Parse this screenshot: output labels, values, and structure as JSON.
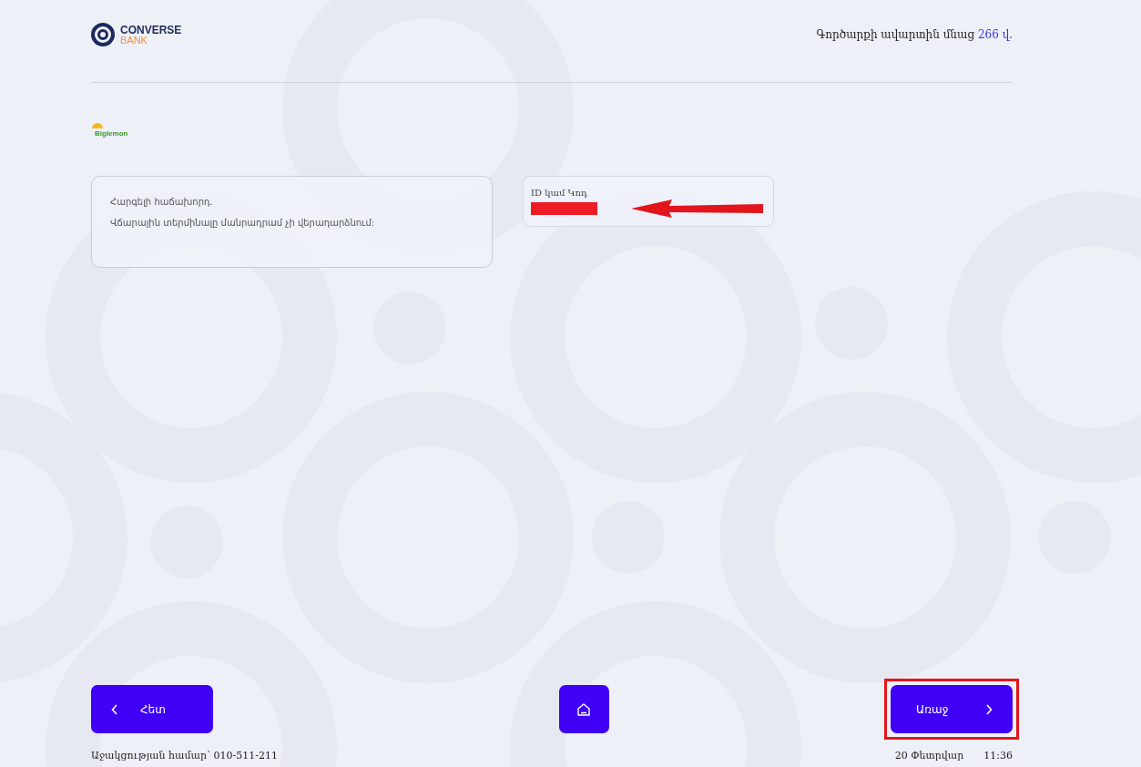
{
  "header": {
    "logo": {
      "name": "CONVERSE",
      "sub": "BANK"
    },
    "timer_label": "Գործարքի ավարտին մնաց",
    "timer_value": "266 վ."
  },
  "merchant": {
    "logo_text": "Biglemon"
  },
  "info_card": {
    "lines": [
      "Հարգելի հաճախորդ.",
      "Վճարային տերմինալը մանրադրամ չի վերադարձնում:"
    ]
  },
  "id_field": {
    "label": "ID կամ Կոդ",
    "redacted": true,
    "arrow": true
  },
  "buttons": [
    {
      "kind": "back",
      "label": "Հետ",
      "highlighted": false
    },
    {
      "kind": "home",
      "highlighted": false
    },
    {
      "kind": "next",
      "label": "Առաջ",
      "highlighted": true
    }
  ],
  "footer": {
    "support": "Աջակցության համար՝ 010-511-211",
    "date": "20 Փետրվար",
    "time": "11:36"
  }
}
